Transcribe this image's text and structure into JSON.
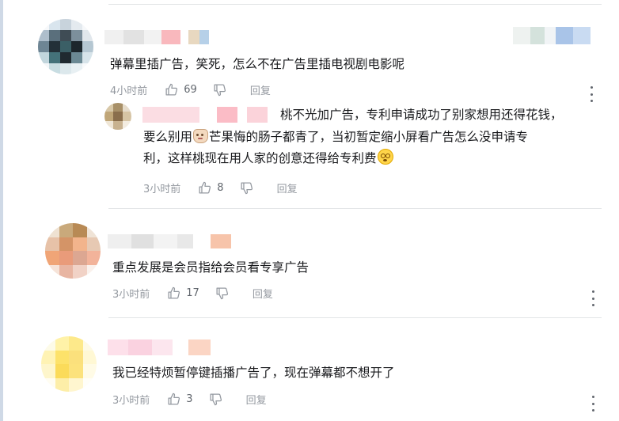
{
  "comments": [
    {
      "text": "弹幕里插广告，笑死，怎么不在广告里插电视剧电影呢",
      "time": "4小时前",
      "likes": "69",
      "reply_label": "回复",
      "more_icon": "more-vertical-icon",
      "reply": {
        "text_line1": "桃不光加广告，专利申请成功了别家想用还得花钱，",
        "text_line2a": "要么别用",
        "text_line2b": "芒果悔的肠子都青了，当初暂定缩小屏看广告怎么没申请专",
        "text_line3": "利，这样桃现在用人家的创意还得给专利费",
        "emoji1": "mango-face-emoji",
        "emoji2": "dizzy-face-emoji",
        "time": "3小时前",
        "likes": "8",
        "reply_label": "回复"
      }
    },
    {
      "text": "重点发展是会员指给会员看专享广告",
      "time": "3小时前",
      "likes": "17",
      "reply_label": "回复",
      "more_icon": "more-vertical-icon"
    },
    {
      "text": "我已经特烦暂停键插播广告了，现在弹幕都不想开了",
      "time": "3小时前",
      "likes": "3",
      "reply_label": "回复",
      "more_icon": "more-vertical-icon"
    }
  ],
  "icons": {
    "like": "thumbs-up-icon",
    "dislike": "thumbs-down-icon"
  },
  "colors": {
    "text": "#18191c",
    "meta": "#9499a0",
    "divider": "#e3e5e7"
  }
}
